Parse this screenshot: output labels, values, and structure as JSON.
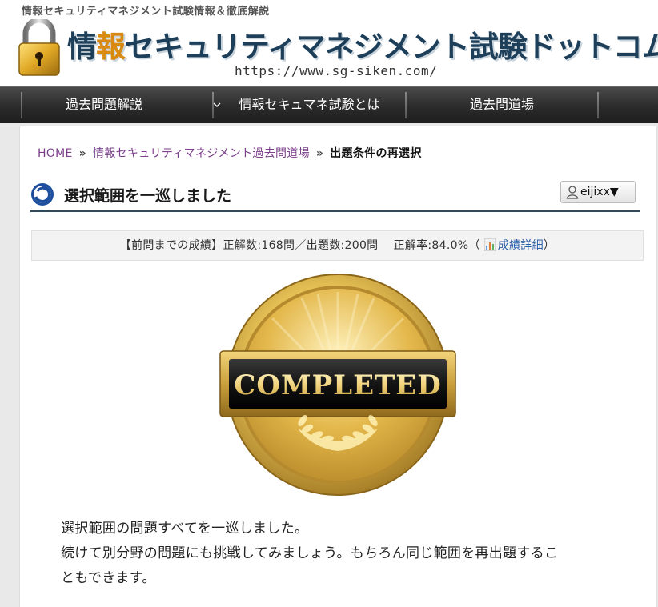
{
  "site": {
    "tagline": "情報セキュリティマネジメント試験情報＆徹底解説",
    "title_prefix": "情",
    "title_highlight": "報",
    "title_suffix": "セキュリティマネジメント試験ドットコム",
    "url": "https://www.sg-siken.com/"
  },
  "nav": {
    "items": [
      {
        "label": "過去問題解説"
      },
      {
        "label": "情報セキュマネ試験とは"
      },
      {
        "label": "過去問道場"
      }
    ]
  },
  "breadcrumb": {
    "home": "HOME",
    "separator": "»",
    "section": "情報セキュリティマネジメント過去問道場",
    "current": "出題条件の再選択"
  },
  "page": {
    "heading": "選択範囲を一巡しました",
    "user_label": "eijixx▼"
  },
  "score": {
    "prefix": "【前問までの成績】",
    "correct": "正解数:168問",
    "slash": "／",
    "total": "出題数:200問",
    "rate": "正解率:84.0%",
    "open_paren": "（",
    "detail_link": "成績詳細",
    "close_paren": "）"
  },
  "medal": {
    "label": "COMPLETED"
  },
  "message": {
    "line1": "選択範囲の問題すべてを一巡しました。",
    "line2": "続けて別分野の問題にも挑戦してみましょう。もちろん同じ範囲を再出題するこ",
    "line3": "ともできます。"
  },
  "colors": {
    "nav_bg": "#2b2b2b",
    "title": "#1d3f5a",
    "highlight": "#d98a12",
    "link": "#7a3e8a",
    "gold": "#d4a83a"
  }
}
